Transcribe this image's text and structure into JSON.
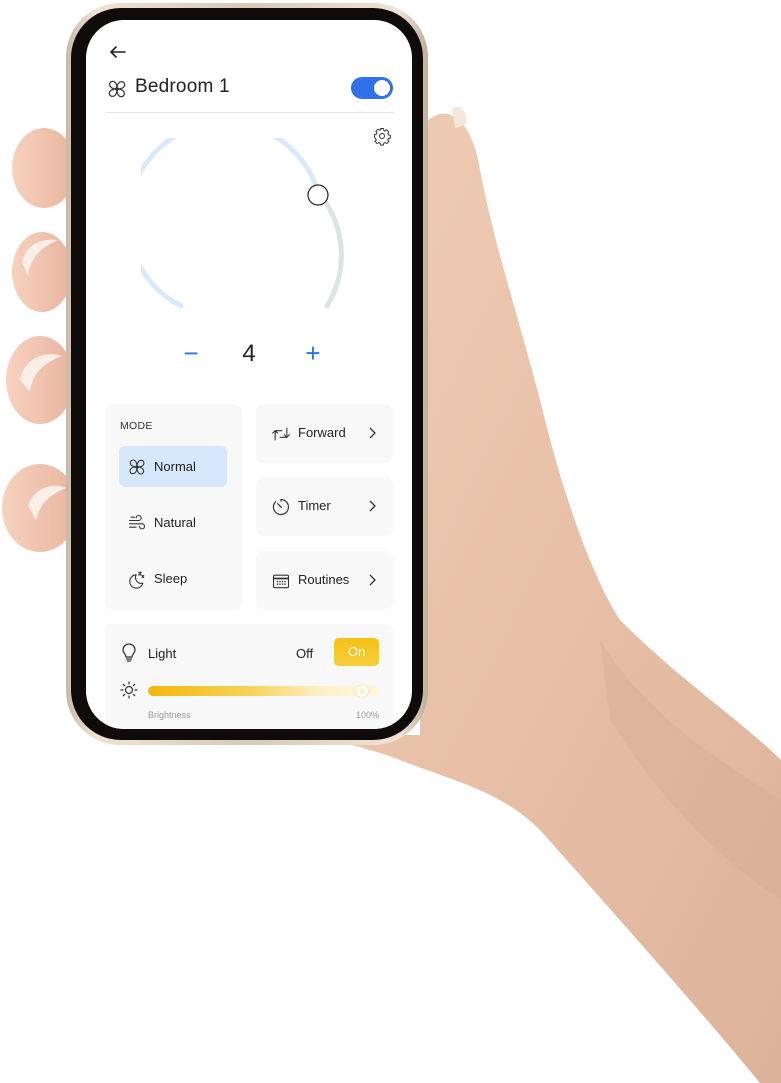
{
  "device": {
    "name": "Bedroom 1",
    "power_on": true,
    "icon": "fan-icon"
  },
  "header": {
    "back_icon": "arrow-left-icon",
    "settings_icon": "gear-icon"
  },
  "speed": {
    "value": "4",
    "level": 4,
    "max_level": 5,
    "minus_label": "−",
    "plus_label": "+"
  },
  "mode": {
    "label": "MODE",
    "items": [
      {
        "label": "Normal",
        "icon": "fan-icon",
        "active": true
      },
      {
        "label": "Natural",
        "icon": "wind-icon",
        "active": false
      },
      {
        "label": "Sleep",
        "icon": "moon-sleep-icon",
        "active": false
      }
    ]
  },
  "actions": [
    {
      "label": "Forward",
      "icon": "rotate-arrows-icon"
    },
    {
      "label": "Timer",
      "icon": "timer-icon"
    },
    {
      "label": "Routines",
      "icon": "calendar-icon"
    }
  ],
  "light": {
    "label": "Light",
    "off_label": "Off",
    "on_label": "On",
    "state": "On",
    "brightness_label": "Brightness",
    "brightness_value": "100%",
    "brightness_percent": 100
  },
  "colors": {
    "accent_blue": "#2f71e8",
    "active_mode_bg": "#d6e7fc",
    "light_on": "#f5c116",
    "dial_track": "#d9e8fb",
    "dial_rest": "#dde2e2"
  }
}
